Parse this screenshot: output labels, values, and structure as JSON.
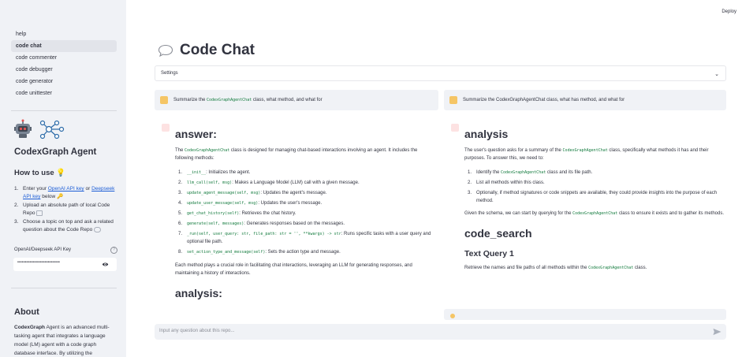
{
  "header": {
    "deploy_label": "Deploy"
  },
  "sidebar": {
    "nav": [
      {
        "label": "help"
      },
      {
        "label": "code chat",
        "active": true
      },
      {
        "label": "code commenter"
      },
      {
        "label": "code debugger"
      },
      {
        "label": "code generator"
      },
      {
        "label": "code unittester"
      }
    ],
    "agent_title": "CodexGraph Agent",
    "howto_title": "How to use",
    "howto_icon": "lightbulb-emoji",
    "steps": {
      "s1_prefix": "Enter your ",
      "s1_link1": "OpenAI API key",
      "s1_or": " or ",
      "s1_link2": "Deepseek API key",
      "s1_suffix": " below",
      "s2": "Upload an absolute path of local Code Repo",
      "s3": "Choose a topic on top and ask a related question about the Code Repo"
    },
    "api_key_label": "OpenAI/Deepseek API Key",
    "api_key_value": "••••••••••••••••••••••••••••",
    "about_title": "About",
    "about_bold": "CodexGraph",
    "about_text": " Agent is an advanced multi-tasking agent that integrates a language model (LM) agent with a code graph database interface. By utilizing the"
  },
  "main": {
    "title": "Code Chat",
    "settings_label": "Settings",
    "user_msg_left": {
      "pre": "Summarize the ",
      "code": "CodexGraphAgentChat",
      "post": " class, what method, and what for"
    },
    "user_msg_right": "Summarize the CodexGraphAgentChat class, what has method, and what for",
    "left": {
      "heading": "answer:",
      "intro_pre": "The ",
      "intro_code": "CodexGraphAgentChat",
      "intro_post": " class is designed for managing chat-based interactions involving an agent. It includes the following methods:",
      "methods": [
        {
          "code": "__init__",
          "desc": ": Initializes the agent."
        },
        {
          "code": "llm_call(self, msg)",
          "desc": ": Makes a Language Model (LLM) call with a given message."
        },
        {
          "code": "update_agent_message(self, msg)",
          "desc": ": Updates the agent's message."
        },
        {
          "code": "update_user_message(self, msg)",
          "desc": ": Updates the user's message."
        },
        {
          "code": "get_chat_history(self)",
          "desc": ": Retrieves the chat history."
        },
        {
          "code": "generate(self, messages)",
          "desc": ": Generates responses based on the messages."
        },
        {
          "code": "_run(self, user_query: str, file_path: str = '', **kwargs) -> str",
          "desc": ": Runs specific tasks with a user query and optional file path."
        },
        {
          "code": "set_action_type_and_message(self)",
          "desc": ": Sets the action type and message."
        }
      ],
      "summary": "Each method plays a crucial role in facilitating chat interactions, leveraging an LLM for generating responses, and maintaining a history of interactions.",
      "heading2": "analysis:"
    },
    "right": {
      "heading": "analysis",
      "intro_pre": "The user's question asks for a summary of the ",
      "intro_code": "CodexGraphAgentChat",
      "intro_post": " class, specifically what methods it has and their purposes. To answer this, we need to:",
      "steps": [
        {
          "pre": "Identify the ",
          "code": "CodexGraphAgentChat",
          "post": " class and its file path."
        },
        {
          "pre": "List all methods within this class.",
          "code": "",
          "post": ""
        },
        {
          "pre": "Optionally, if method signatures or code snippets are available, they could provide insights into the purpose of each method.",
          "code": "",
          "post": ""
        }
      ],
      "schema_pre": "Given the schema, we can start by querying for the ",
      "schema_code": "CodexGraphAgentChat",
      "schema_post": " class to ensure it exists and to gather its methods.",
      "heading2": "code_search",
      "heading3": "Text Query 1",
      "query_pre": "Retrieve the names and file paths of all methods within the ",
      "query_code": "CodexGraphAgentChat",
      "query_post": " class."
    },
    "chat_placeholder": "Input any question about this repo..."
  },
  "colors": {
    "sidebar_bg": "#f0f2f6",
    "code_green": "#117a3c",
    "link_blue": "#1c5dd6"
  }
}
